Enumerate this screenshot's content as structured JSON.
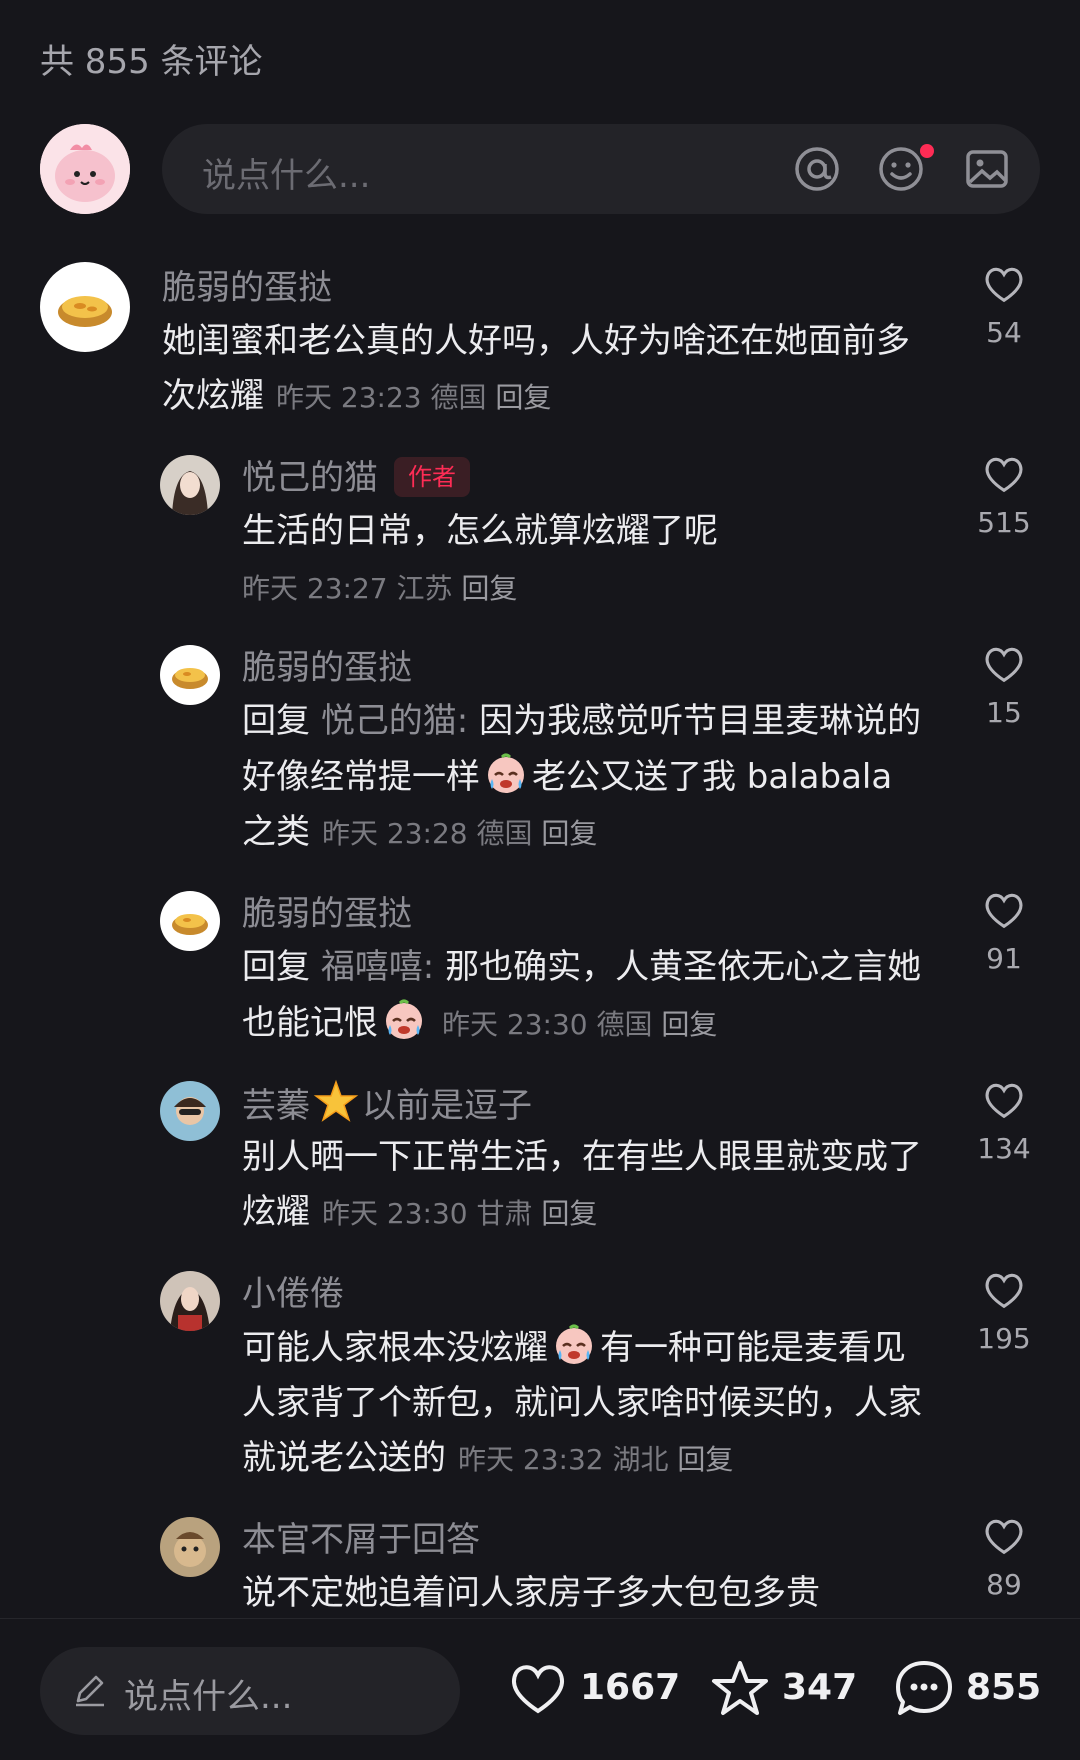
{
  "header": {
    "count_title": "共 855 条评论"
  },
  "composer": {
    "placeholder": "说点什么...",
    "icons": [
      "at-icon",
      "emoji-icon",
      "image-icon"
    ]
  },
  "comments": [
    {
      "username": "脆弱的蛋挞",
      "text": "她闺蜜和老公真的人好吗，人好为啥还在她面前多次炫耀",
      "time": "昨天 23:23",
      "location": "德国",
      "reply": "回复",
      "likes": "54"
    },
    {
      "username": "悦己的猫",
      "badge": "作者",
      "text": "生活的日常，怎么就算炫耀了呢",
      "time": "昨天 23:27",
      "location": "江苏",
      "reply": "回复",
      "likes": "515"
    },
    {
      "username": "脆弱的蛋挞",
      "reply_prefix": "回复",
      "reply_to": "悦己的猫:",
      "text_a": " 因为我感觉听节目里麦琳说的好像经常提一样",
      "text_b": "老公又送了我 balabala 之类",
      "time": "昨天 23:28",
      "location": "德国",
      "reply": "回复",
      "likes": "15"
    },
    {
      "username": "脆弱的蛋挞",
      "reply_prefix": "回复",
      "reply_to": "福嘻嘻:",
      "text_a": " 那也确实，人黄圣依无心之言她也能记恨",
      "time": "昨天 23:30",
      "location": "德国",
      "reply": "回复",
      "likes": "91"
    },
    {
      "username_a": "芸蓁",
      "username_b": "以前是逗子",
      "text": "别人晒一下正常生活，在有些人眼里就变成了炫耀",
      "time": "昨天 23:30",
      "location": "甘肃",
      "reply": "回复",
      "likes": "134"
    },
    {
      "username": "小倦倦",
      "text_a": "可能人家根本没炫耀",
      "text_b": "有一种可能是麦看见人家背了个新包，就问人家啥时候买的，人家就说老公送的",
      "time": "昨天 23:32",
      "location": "湖北",
      "reply": "回复",
      "likes": "195"
    },
    {
      "username": "本官不屑于回答",
      "text": "说不定她追着问人家房子多大包包多贵",
      "likes": "89"
    }
  ],
  "bottom_bar": {
    "placeholder": "说点什么...",
    "likes": "1667",
    "favorites": "347",
    "comments": "855"
  },
  "colors": {
    "background": "#16161b",
    "accent": "#fe2c55"
  }
}
